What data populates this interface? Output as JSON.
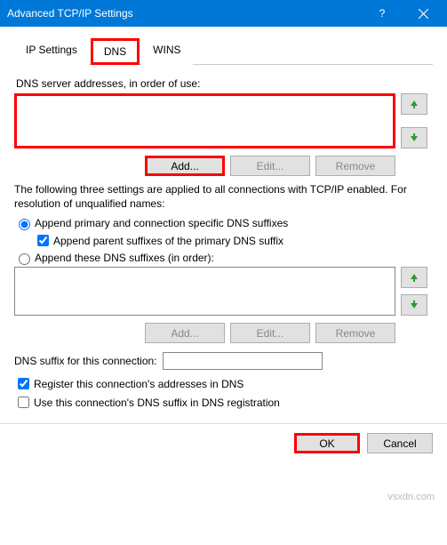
{
  "title": "Advanced TCP/IP Settings",
  "tabs": {
    "ip": "IP Settings",
    "dns": "DNS",
    "wins": "WINS"
  },
  "dns_label": "DNS server addresses, in order of use:",
  "buttons": {
    "add": "Add...",
    "edit": "Edit...",
    "remove": "Remove",
    "ok": "OK",
    "cancel": "Cancel"
  },
  "note": "The following three settings are applied to all connections with TCP/IP enabled. For resolution of unqualified names:",
  "radio1": "Append primary and connection specific DNS suffixes",
  "check_parent": "Append parent suffixes of the primary DNS suffix",
  "radio2": "Append these DNS suffixes (in order):",
  "suffix_label": "DNS suffix for this connection:",
  "check_register": "Register this connection's addresses in DNS",
  "check_usesuffix": "Use this connection's DNS suffix in DNS registration",
  "watermark": "vsxdn.com"
}
